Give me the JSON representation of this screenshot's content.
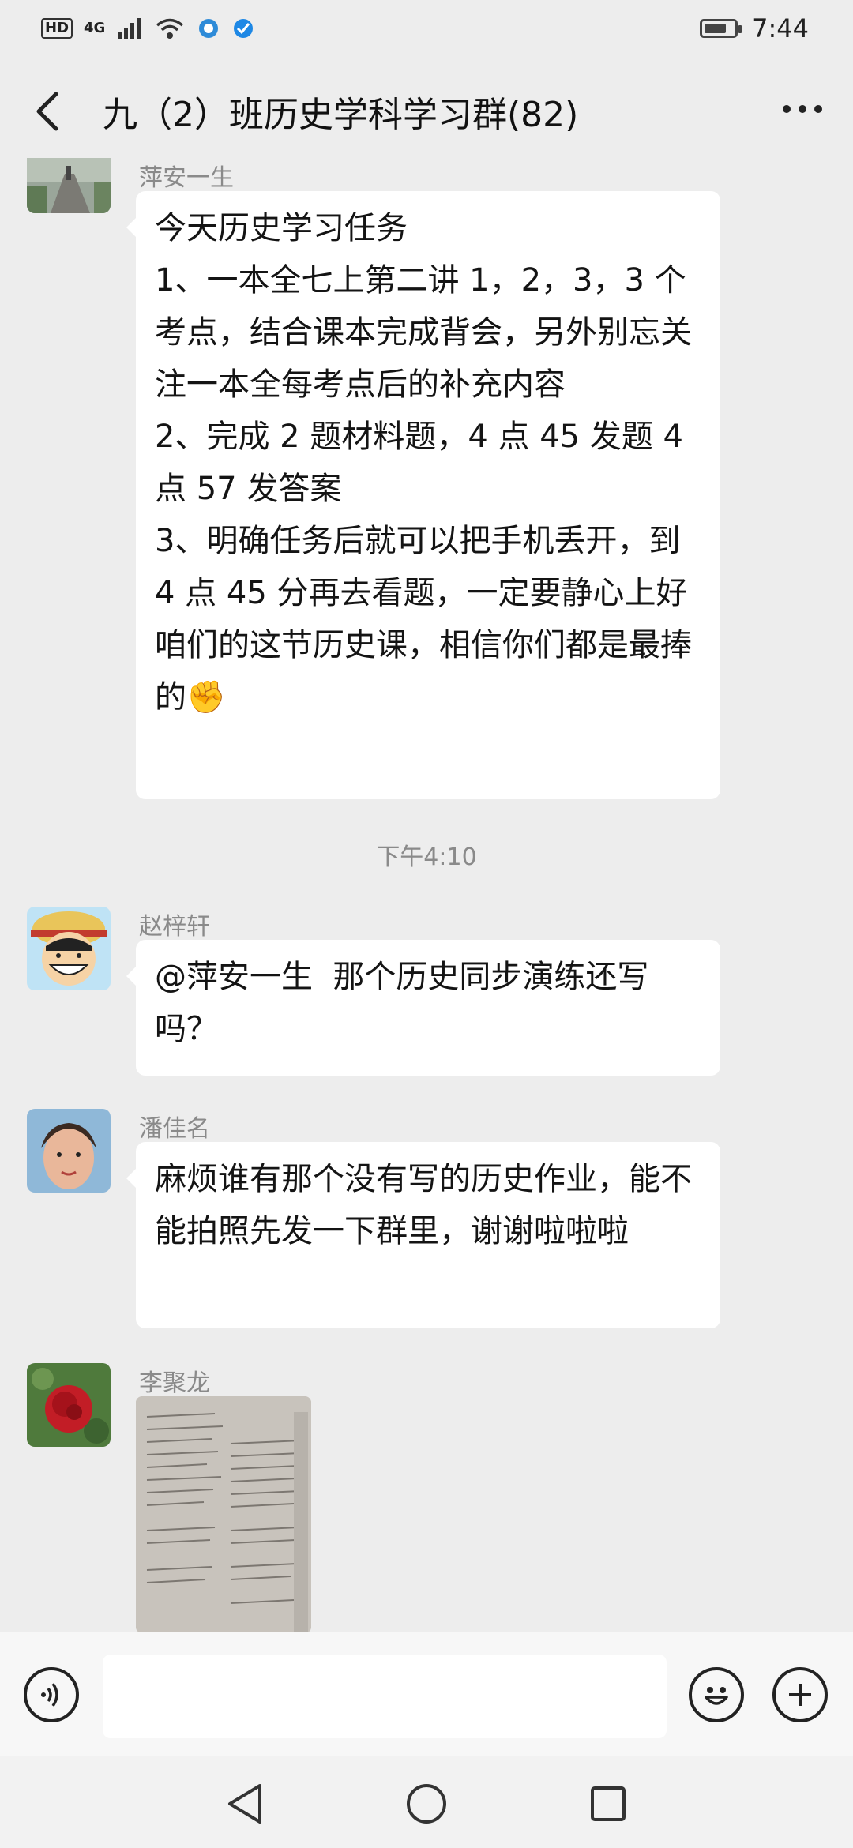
{
  "status_bar": {
    "hd": "HD",
    "network": "4G",
    "time": "7:44",
    "battery_level": 0.75
  },
  "header": {
    "title": "九（2）班历史学科学习群(82)"
  },
  "messages": [
    {
      "sender": "萍安一生",
      "text": "今天历史学习任务\n1、一本全七上第二讲 1，2，3，3 个考点，结合课本完成背会，另外别忘关注一本全每考点后的补充内容\n2、完成 2 题材料题，4 点 45 发题 4 点 57 发答案\n3、明确任务后就可以把手机丢开，到 4 点 45 分再去看题，一定要静心上好咱们的这节历史课，相信你们都是最捧的",
      "emoji": "✊"
    },
    {
      "sender": "赵梓轩",
      "text": "@萍安一生  那个历史同步演练还写吗？"
    },
    {
      "sender": "潘佳名",
      "text": "麻烦谁有那个没有写的历史作业，能不能拍照先发一下群里，谢谢啦啦啦"
    },
    {
      "sender": "李聚龙"
    }
  ],
  "timestamp": "下午4:10",
  "input": {
    "placeholder": ""
  },
  "icons": [
    "back-icon",
    "more-icon",
    "voice-icon",
    "emoji-icon",
    "add-icon",
    "nav-back-icon",
    "nav-home-icon",
    "nav-recent-icon"
  ]
}
